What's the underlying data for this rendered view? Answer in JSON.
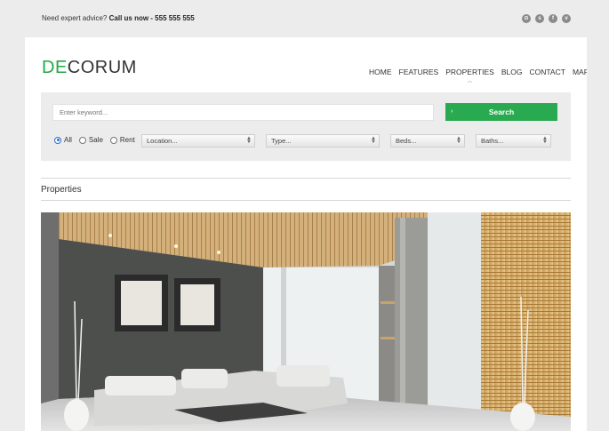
{
  "topbar": {
    "advice_text": "Need expert advice?",
    "call_text": "Call us now - 555 555 555",
    "socials": [
      {
        "icon": "rss-icon",
        "glyph": "⊙"
      },
      {
        "icon": "skype-icon",
        "glyph": "s"
      },
      {
        "icon": "facebook-icon",
        "glyph": "f"
      },
      {
        "icon": "vimeo-icon",
        "glyph": "v"
      }
    ]
  },
  "logo": {
    "part1": "DE",
    "part2": "CORUM"
  },
  "nav": {
    "items": [
      "HOME",
      "FEATURES",
      "PROPERTIES",
      "BLOG",
      "CONTACT",
      "MAP"
    ],
    "active": "PROPERTIES"
  },
  "search": {
    "keyword_placeholder": "Enter keyword...",
    "button_label": "Search",
    "button_arrow": "›",
    "radios": [
      {
        "label": "All",
        "checked": true
      },
      {
        "label": "Sale",
        "checked": false
      },
      {
        "label": "Rent",
        "checked": false
      }
    ],
    "selects": {
      "location": "Location...",
      "type": "Type...",
      "beds": "Beds...",
      "baths": "Baths..."
    }
  },
  "properties": {
    "title": "Properties"
  },
  "colors": {
    "brand": "#22a845",
    "button": "#2aaa50",
    "panel": "#ececec",
    "page_bg": "#ececec"
  }
}
